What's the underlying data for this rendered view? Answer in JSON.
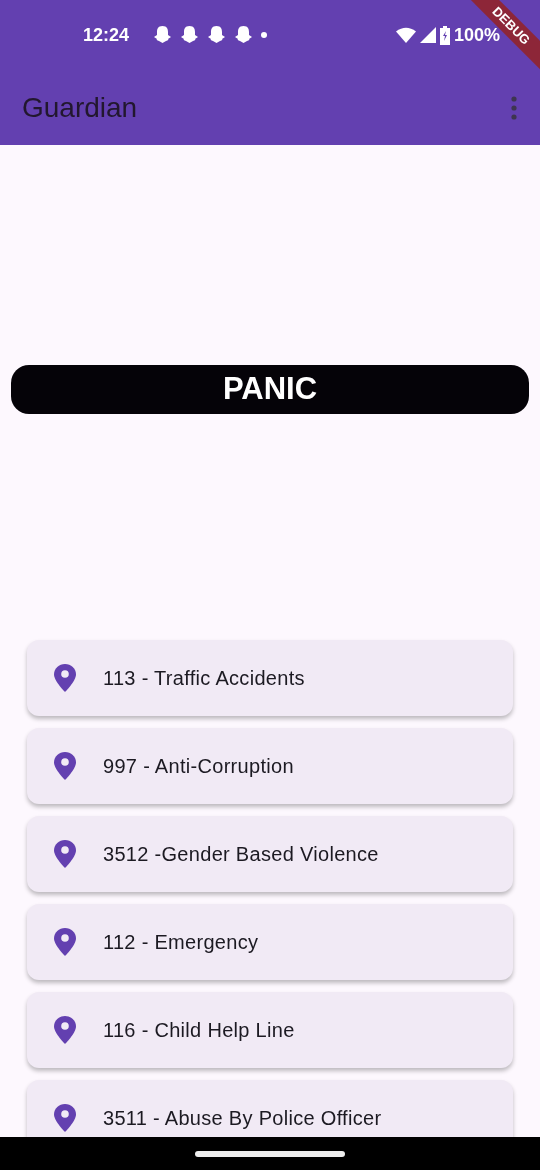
{
  "status_bar": {
    "time": "12:24",
    "battery": "100%"
  },
  "debug_banner": "DEBUG",
  "app_bar": {
    "title": "Guardian"
  },
  "panic_button": {
    "label": "PANIC"
  },
  "hotlines": [
    {
      "label": "113 - Traffic Accidents"
    },
    {
      "label": "997 - Anti-Corruption"
    },
    {
      "label": "3512 -Gender Based Violence"
    },
    {
      "label": "112 - Emergency"
    },
    {
      "label": "116 - Child Help Line"
    },
    {
      "label": "3511 - Abuse By Police Officer"
    }
  ]
}
